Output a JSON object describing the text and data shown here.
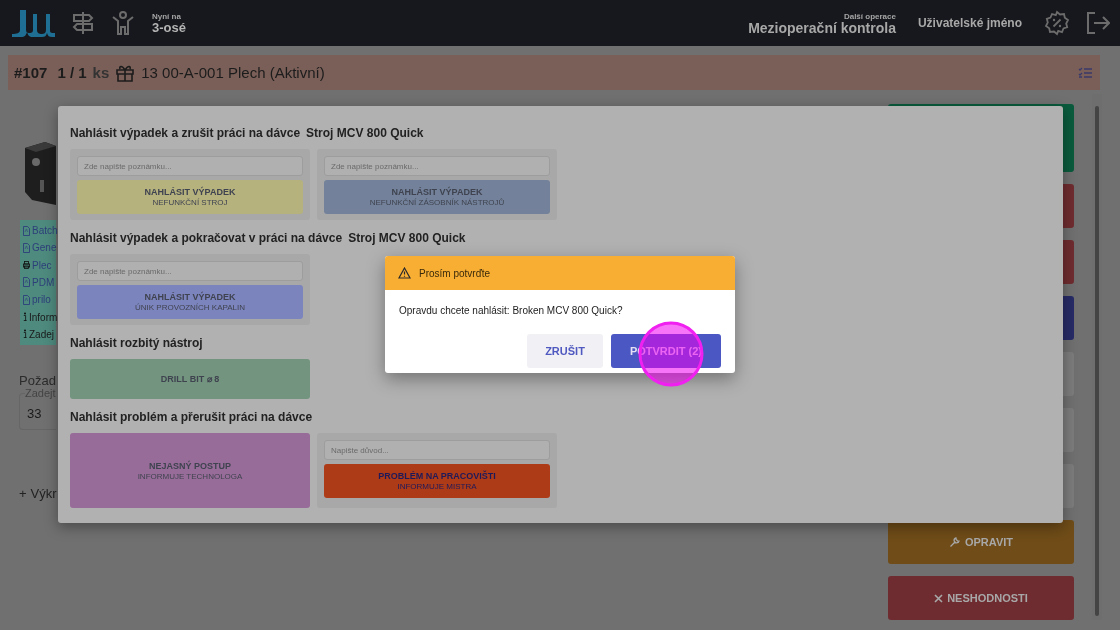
{
  "header": {
    "current_label": "Nyní na",
    "current_value": "3-osé",
    "next_label": "Další operace",
    "next_value": "Mezioperační kontrola",
    "user": "Uživatelské jméno"
  },
  "order_bar": {
    "number": "#107",
    "quantity": "1 / 1",
    "unit": "ks",
    "part": "13 00-A-001 Plech (Aktivní)"
  },
  "documents": [
    {
      "kind": "pdf",
      "label": "Batch"
    },
    {
      "kind": "pdf",
      "label": "Gene"
    },
    {
      "kind": "print",
      "label": "Plec"
    },
    {
      "kind": "pdf",
      "label": "PDM"
    },
    {
      "kind": "pdf",
      "label": "prilo"
    },
    {
      "kind": "info",
      "label": "Inform"
    },
    {
      "kind": "info",
      "label": "Zadej"
    }
  ],
  "requirement": {
    "title": "Požad",
    "field_label": "Zadejt",
    "value": "33"
  },
  "add_link": {
    "icon": "+",
    "label": "Výkr"
  },
  "side_buttons": [
    {
      "kind": "blank",
      "color": "#0a5b3d"
    },
    {
      "kind": "blank",
      "color": "#6f2c30"
    },
    {
      "kind": "blank",
      "color": "#6f2c30"
    },
    {
      "kind": "blank",
      "color": "#272b66"
    },
    {
      "kind": "blank",
      "color": "#7c7c7c"
    },
    {
      "kind": "blank",
      "color": "#7c7c7c"
    },
    {
      "kind": "blank",
      "color": "#7c7c7c"
    },
    {
      "kind": "repair",
      "label": "OPRAVIT",
      "color": "#6f4c18"
    },
    {
      "kind": "reject",
      "label": "NESHODNOSTI",
      "color": "#6f2c30"
    }
  ],
  "modal": {
    "sections": [
      {
        "title": "Nahlásit výpadek a zrušit práci na dávce",
        "machine": "Stroj MCV 800 Quick",
        "cards": [
          {
            "kind": "note_button",
            "placeholder": "Zde napište poznámku...",
            "title": "NAHLÁSIT VÝPADEK",
            "subtitle": "NEFUNKČNÍ STROJ",
            "color": "#b6b27e"
          },
          {
            "kind": "note_button",
            "placeholder": "Zde napište poznámku...",
            "title": "NAHLÁSIT VÝPADEK",
            "subtitle": "NEFUNKČNÍ ZÁSOBNÍK NÁSTROJŮ",
            "color": "#73829a"
          }
        ]
      },
      {
        "title": "Nahlásit výpadek a pokračovat v práci na dávce",
        "machine": "Stroj MCV 800 Quick",
        "cards": [
          {
            "kind": "note_button",
            "placeholder": "Zde napište poznámku...",
            "title": "NAHLÁSIT VÝPADEK",
            "subtitle": "ÚNIK PROVOZNÍCH KAPALIN",
            "color": "#7c84bd"
          }
        ]
      },
      {
        "title": "Nahlásit rozbitý nástroj",
        "cards": [
          {
            "kind": "button",
            "title": "DRILL BIT ⌀ 8",
            "color": "#73947e"
          }
        ]
      },
      {
        "title": "Nahlásit problém a přerušit práci na dávce",
        "cards": [
          {
            "kind": "button",
            "title": "NEJASNÝ POSTUP",
            "subtitle": "INFORMUJE TECHNOLOGA",
            "color": "#986c98"
          },
          {
            "kind": "note_button",
            "placeholder": "Napište důvod...",
            "title": "PROBLÉM NA PRACOVIŠTI",
            "subtitle": "INFORMUJE MISTRA",
            "color": "#ae3b18"
          }
        ]
      }
    ]
  },
  "dialog": {
    "title": "Prosím potvrďte",
    "message": "Opravdu chcete nahlásit: Broken MCV 800 Quick?",
    "buttons": [
      {
        "kind": "secondary",
        "label": "ZRUŠIT"
      },
      {
        "kind": "primary",
        "label": "POTVRDIT (2)"
      }
    ]
  }
}
